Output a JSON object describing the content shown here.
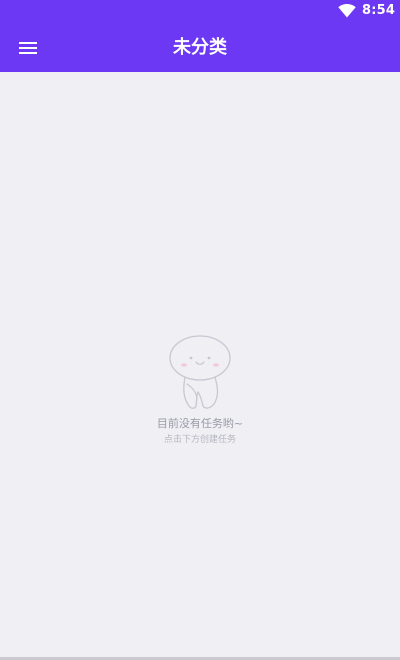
{
  "status_bar": {
    "time": "8:54",
    "wifi_icon": "wifi-icon"
  },
  "app_bar": {
    "title": "未分类",
    "menu_icon": "menu-icon",
    "background": "#6c38f3"
  },
  "empty_state": {
    "illustration": "ghost-mascot-illustration",
    "title": "目前没有任务哟~",
    "hint": "点击下方创建任务"
  },
  "colors": {
    "page_background": "#efeff4",
    "text_primary_on_bar": "#ffffff"
  }
}
